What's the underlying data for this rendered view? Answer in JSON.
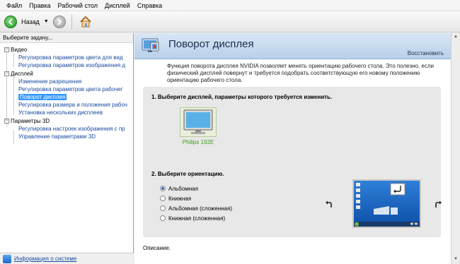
{
  "menu": [
    "Файл",
    "Правка",
    "Рабочий стол",
    "Дисплей",
    "Справка"
  ],
  "toolbar": {
    "back_label": "Назад"
  },
  "left": {
    "header": "Выберите задачу...",
    "categories": [
      {
        "label": "Видео",
        "items": [
          "Регулировка параметров цвета для вид",
          "Регулировка параметров изображения д"
        ]
      },
      {
        "label": "Дисплей",
        "items": [
          "Изменение разрешения",
          "Регулировка параметров цвета рабочег",
          "Поворот дисплея",
          "Регулировка размера и положения рабоч",
          "Установка нескольких дисплеев"
        ]
      },
      {
        "label": "Параметры 3D",
        "items": [
          "Регулировка настроек изображения с пр",
          "Управление параметрами 3D"
        ]
      }
    ],
    "footer_link": "Информация о системе"
  },
  "main": {
    "title": "Поворот дисплея",
    "restore": "Восстановить",
    "description": "Функция поворота дисплея NVIDIA позволяет менять ориентацию рабочего стола. Это полезно, если физический дисплей повернут и требуется подобрать соответствующую его новому положению ориентацию рабочего стола.",
    "step1": "1. Выберите дисплей, параметры которого требуется изменить.",
    "display_name": "Philips 192E",
    "step2": "2. Выберите ориентацию.",
    "orientations": [
      "Альбомная",
      "Книжная",
      "Альбомная (сложенная)",
      "Книжная (сложенная)"
    ],
    "selected_orientation": "Альбомная",
    "footer": "Описание."
  },
  "colors": {
    "accent": "#3399ff",
    "banner": "#c7dbef",
    "display_label": "#3c9a1c"
  }
}
